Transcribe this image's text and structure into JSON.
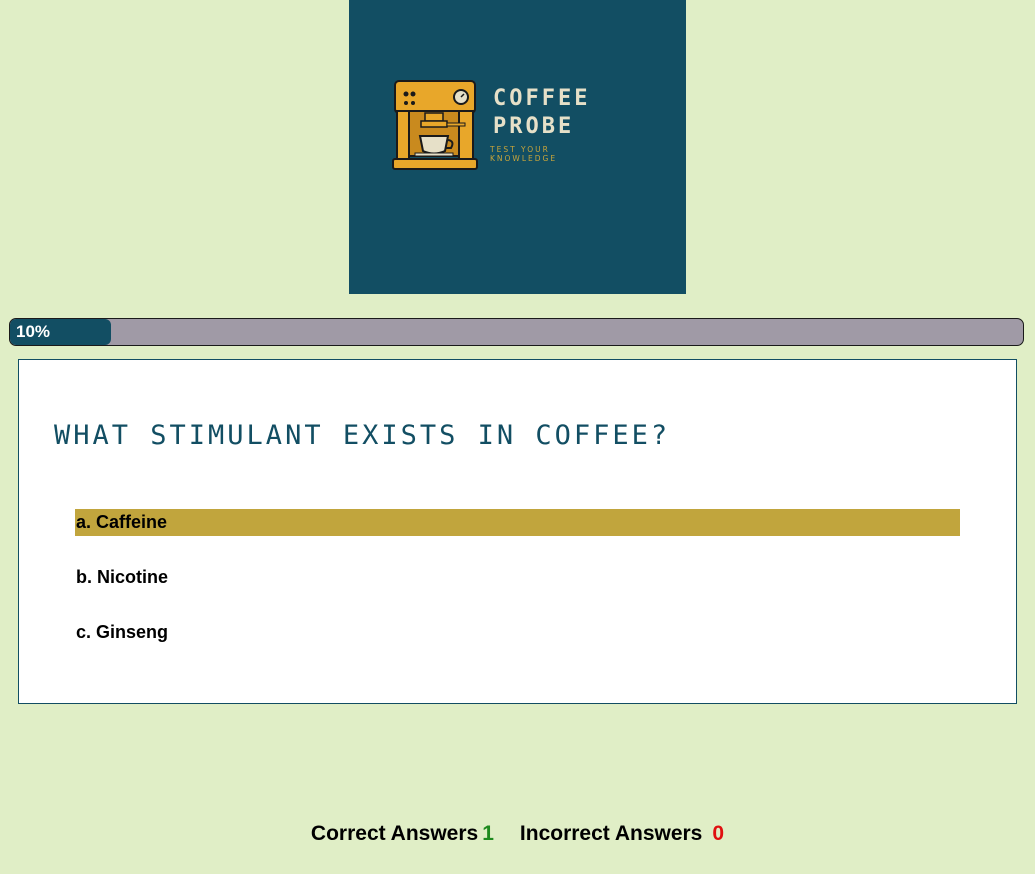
{
  "logo": {
    "word1": "COFFEE",
    "word2": "PROBE",
    "tagline": "TEST YOUR KNOWLEDGE",
    "background_color": "#124e63",
    "icon": "coffee-machine-icon"
  },
  "progress": {
    "label": "10%",
    "value": 0.1,
    "fill_color": "#124e63",
    "track_color": "#a09aa6"
  },
  "quiz": {
    "question": "What stimulant exists in coffee?",
    "options": [
      {
        "label": "a. Caffeine",
        "selected": true
      },
      {
        "label": "b. Nicotine",
        "selected": false
      },
      {
        "label": "c. Ginseng",
        "selected": false
      }
    ],
    "selected_color": "#c1a53d"
  },
  "score": {
    "correct_label": "Correct Answers",
    "correct_count": "1",
    "incorrect_label": "Incorrect Answers",
    "incorrect_count": "0",
    "correct_color": "#1e8a1e",
    "incorrect_color": "#e01010"
  }
}
